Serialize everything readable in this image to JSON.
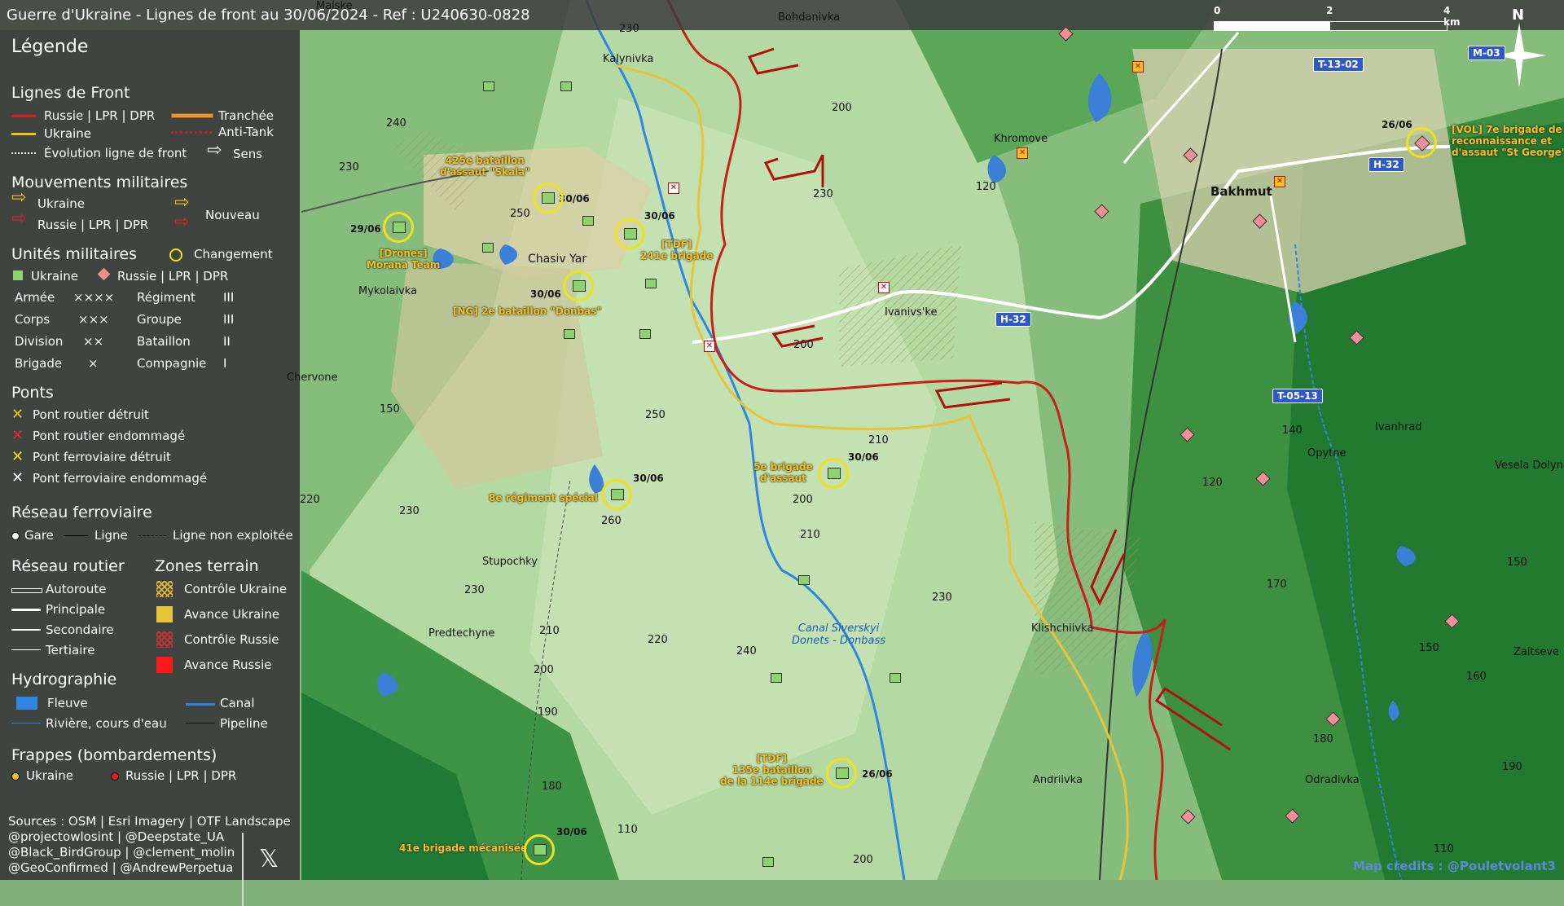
{
  "title": "Guerre d'Ukraine - Lignes de front au 30/06/2024 - Ref : U240630-0828",
  "legend": {
    "title": "Légende",
    "front_lines": {
      "heading": "Lignes de Front",
      "russia": "Russie | LPR | DPR",
      "ukraine": "Ukraine",
      "evolution": "Évolution ligne de front",
      "trench": "Tranchée",
      "antitank": "Anti-Tank",
      "direction": "Sens"
    },
    "movements": {
      "heading": "Mouvements militaires",
      "ukraine": "Ukraine",
      "russia": "Russie | LPR | DPR",
      "new": "Nouveau"
    },
    "units": {
      "heading": "Unités militaires",
      "change": "Changement",
      "ukraine": "Ukraine",
      "russia": "Russie | LPR | DPR",
      "rows": [
        [
          "Armée",
          "××××",
          "Régiment",
          "III"
        ],
        [
          "Corps",
          "×××",
          "Groupe",
          "III"
        ],
        [
          "Division",
          "××",
          "Bataillon",
          "II"
        ],
        [
          "Brigade",
          "×",
          "Compagnie",
          "I"
        ]
      ]
    },
    "bridges": {
      "heading": "Ponts",
      "items": [
        "Pont routier détruit",
        "Pont routier endommagé",
        "Pont ferroviaire détruit",
        "Pont ferroviaire endommagé"
      ],
      "colors": [
        "#f5c518",
        "#e03030",
        "#f5e000",
        "#ffffff"
      ]
    },
    "rail": {
      "heading": "Réseau ferroviaire",
      "station": "Gare",
      "line": "Ligne",
      "unused": "Ligne non exploitée"
    },
    "roads": {
      "heading": "Réseau routier",
      "items": [
        "Autoroute",
        "Principale",
        "Secondaire",
        "Tertiaire"
      ]
    },
    "terrain": {
      "heading": "Zones terrain",
      "items": [
        "Contrôle Ukraine",
        "Avance Ukraine",
        "Contrôle Russie",
        "Avance Russie"
      ],
      "colors": [
        "#d9b23a",
        "#e8c238",
        "#c83232",
        "#ff1a1a"
      ]
    },
    "hydro": {
      "heading": "Hydrographie",
      "river": "Fleuve",
      "canal": "Canal",
      "stream": "Rivière, cours d'eau",
      "pipeline": "Pipeline"
    },
    "strikes": {
      "heading": "Frappes (bombardements)",
      "ukraine": "Ukraine",
      "russia": "Russie | LPR | DPR"
    },
    "sources": [
      "Sources : OSM | Esri Imagery | OTF Landscape",
      "@projectowlosint | @Deepstate_UA",
      "@Black_BirdGroup | @clement_molin",
      "@GeoConfirmed | @AndrewPerpetua"
    ]
  },
  "places": [
    "Bohdanivka",
    "Kalynivka",
    "Chasiv Yar",
    "Mykolaivka",
    "Khromove",
    "Bakhmut",
    "Ivanivs'ke",
    "Opytne",
    "Ivanhrad",
    "Vesela Dolyna",
    "Klishchiivka",
    "Stupochky",
    "Predtechyne",
    "Andriivka",
    "Odradivka",
    "Zaitseve",
    "Chervone",
    "Maiske"
  ],
  "units": [
    {
      "label": "425e bataillon\nd'assaut \"Skala\"",
      "date": "30/06"
    },
    {
      "label": "[Drones]\nMorana Team",
      "date": "29/06"
    },
    {
      "label": "[TDF]\n241e brigade",
      "date": "30/06"
    },
    {
      "label": "[NG] 2e bataillon \"Donbas\"",
      "date": "30/06"
    },
    {
      "label": "8e régiment spécial",
      "date": "30/06"
    },
    {
      "label": "5e brigade\nd'assaut",
      "date": "30/06"
    },
    {
      "label": "[TDF]\n135e bataillon\nde la 114e brigade",
      "date": "26/06"
    },
    {
      "label": "41e brigade mécanisée",
      "date": "30/06"
    },
    {
      "label": "[VOL] 7e brigade de\nreconnaissance et\nd'assaut \"St George\"",
      "date": "26/06"
    }
  ],
  "roads": [
    "H-32",
    "H-32",
    "T-13-02",
    "M-03",
    "T-05-13"
  ],
  "elevations": [
    "230",
    "200",
    "240",
    "230",
    "120",
    "230",
    "250",
    "200",
    "250",
    "150",
    "210",
    "200",
    "210",
    "230",
    "260",
    "220",
    "230",
    "210",
    "200",
    "220",
    "240",
    "190",
    "180",
    "110",
    "200",
    "230",
    "140",
    "120",
    "170",
    "150",
    "160",
    "180",
    "190",
    "110",
    "150"
  ],
  "canal_label": "Canal Siverskyi\nDonets - Donbass",
  "scale": {
    "labels": [
      "0",
      "2",
      "4 km"
    ]
  },
  "north": "N",
  "credits": "Map credits : @Pouletvolant3"
}
